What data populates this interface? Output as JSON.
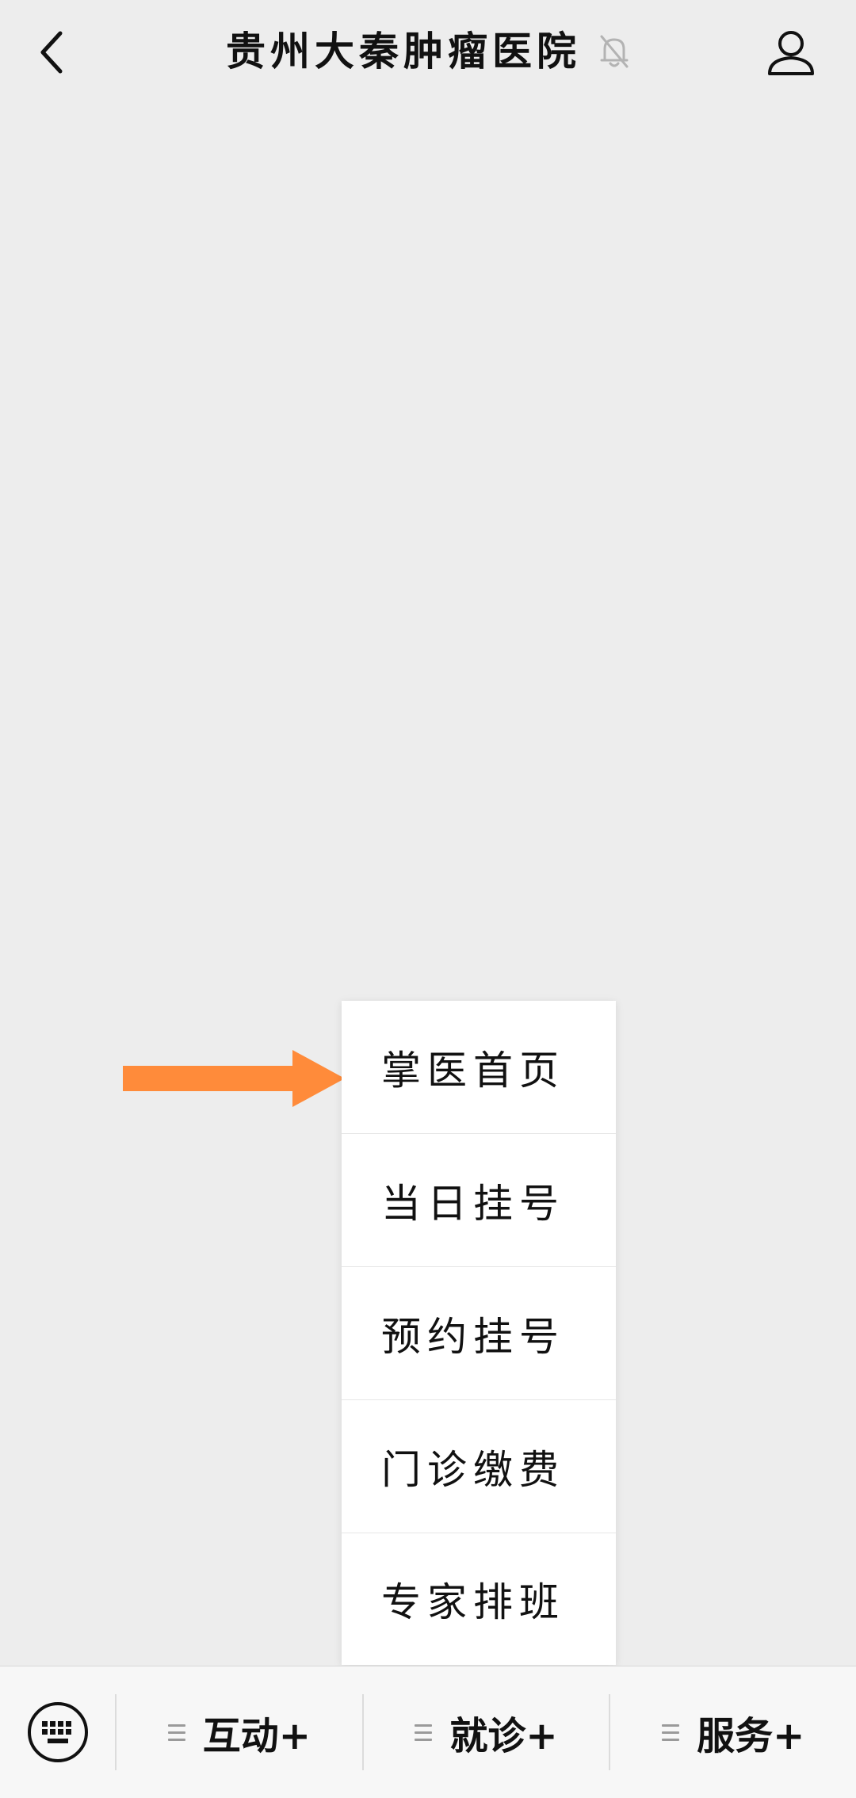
{
  "header": {
    "title": "贵州大秦肿瘤医院",
    "back_icon": "chevron-left-icon",
    "mute_icon": "bell-off-icon",
    "profile_icon": "person-icon"
  },
  "popup_menu": {
    "items": [
      {
        "label": "掌医首页"
      },
      {
        "label": "当日挂号"
      },
      {
        "label": "预约挂号"
      },
      {
        "label": "门诊缴费"
      },
      {
        "label": "专家排班"
      }
    ]
  },
  "annotation": {
    "arrow_color": "#ff8b3a",
    "arrow_icon": "arrow-right-icon"
  },
  "bottom_bar": {
    "keyboard_icon": "keyboard-icon",
    "tabs": [
      {
        "label": "互动+"
      },
      {
        "label": "就诊+"
      },
      {
        "label": "服务+"
      }
    ]
  }
}
